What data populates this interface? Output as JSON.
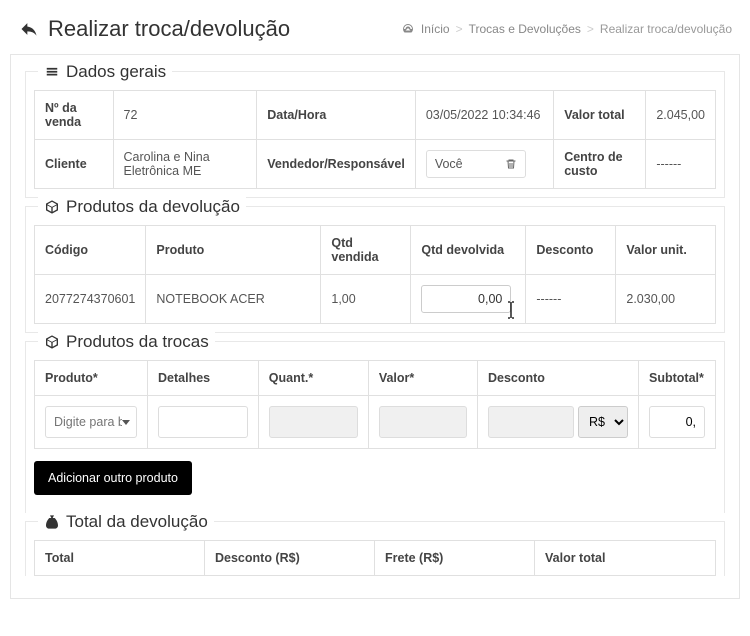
{
  "header": {
    "title": "Realizar troca/devolução",
    "breadcrumb": {
      "home": "Início",
      "mid": "Trocas e Devoluções",
      "current": "Realizar troca/devolução"
    }
  },
  "general": {
    "legend": "Dados gerais",
    "labels": {
      "sale_no": "Nº da venda",
      "datetime": "Data/Hora",
      "total": "Valor total",
      "client": "Cliente",
      "seller": "Vendedor/Responsável",
      "cost_center": "Centro de custo"
    },
    "values": {
      "sale_no": "72",
      "datetime": "03/05/2022 10:34:46",
      "total": "2.045,00",
      "client": "Carolina e Nina Eletrônica ME",
      "seller": "Você",
      "cost_center": "------"
    }
  },
  "return_products": {
    "legend": "Produtos da devolução",
    "headers": {
      "code": "Código",
      "product": "Produto",
      "qty_sold": "Qtd vendida",
      "qty_returned": "Qtd devolvida",
      "discount": "Desconto",
      "unit_value": "Valor unit."
    },
    "rows": [
      {
        "code": "2077274370601",
        "product": "NOTEBOOK ACER",
        "qty_sold": "1,00",
        "qty_returned": "0,00",
        "discount": "------",
        "unit_value": "2.030,00"
      }
    ]
  },
  "exchange_products": {
    "legend": "Produtos da trocas",
    "labels": {
      "product": "Produto*",
      "details": "Detalhes",
      "quant": "Quant.*",
      "value": "Valor*",
      "discount": "Desconto",
      "subtotal": "Subtotal*"
    },
    "placeholders": {
      "product": "Digite para b"
    },
    "currency_option": "R$",
    "subtotal_value": "0,",
    "add_button": "Adicionar outro produto"
  },
  "totals": {
    "legend": "Total da devolução",
    "headers": {
      "total": "Total",
      "discount": "Desconto (R$)",
      "freight": "Frete (R$)",
      "total_value": "Valor total"
    }
  }
}
